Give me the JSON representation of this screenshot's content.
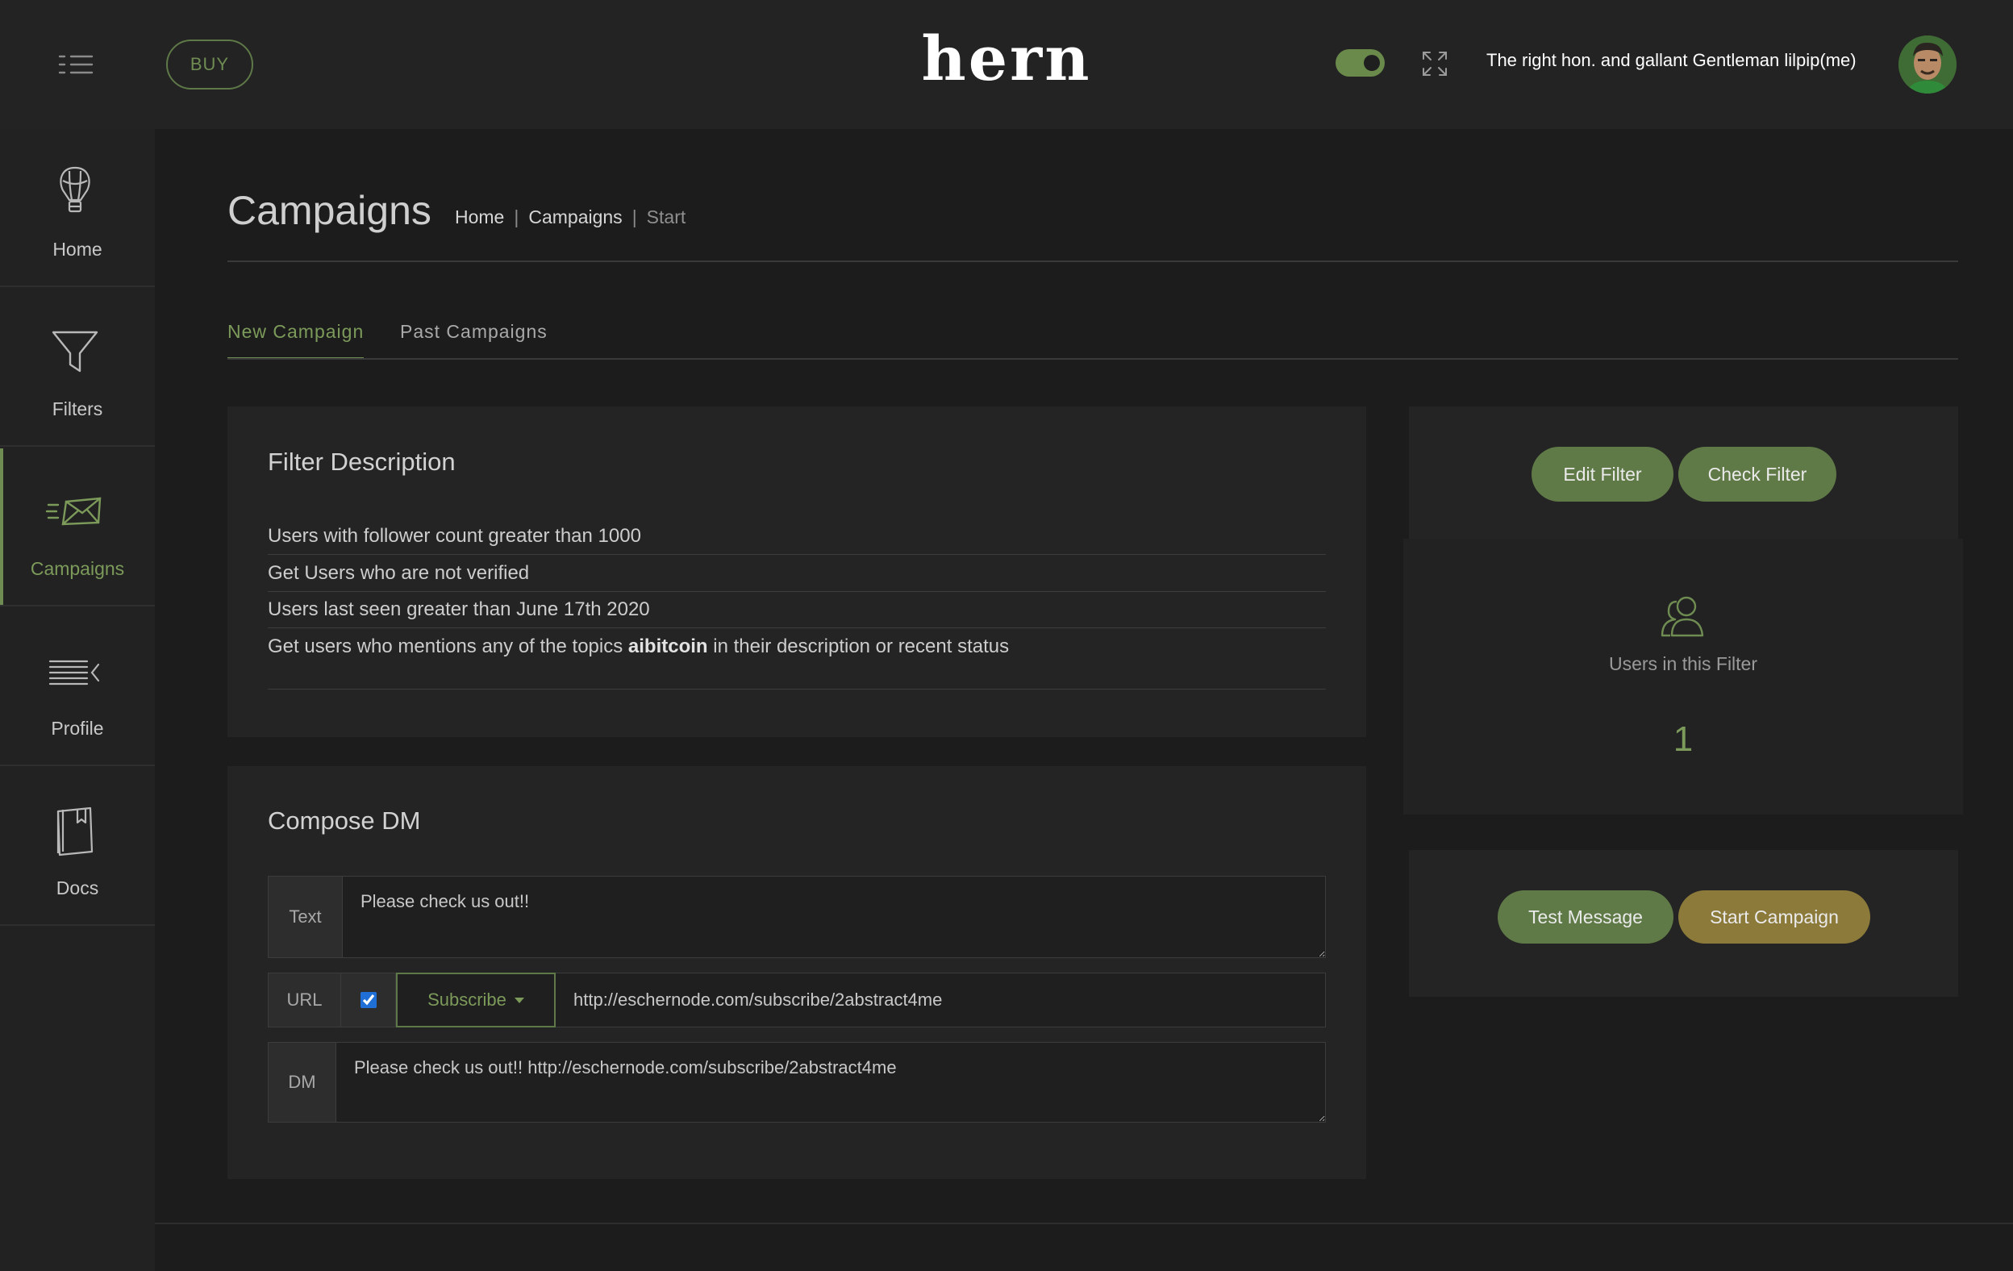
{
  "topbar": {
    "buy_label": "BUY",
    "logo": "hern",
    "username": "The right hon. and gallant Gentleman lilpip(me)",
    "theme_toggle_on": true
  },
  "sidebar": {
    "items": [
      {
        "label": "Home",
        "icon": "balloon-icon"
      },
      {
        "label": "Filters",
        "icon": "funnel-icon"
      },
      {
        "label": "Campaigns",
        "icon": "mail-icon",
        "active": true
      },
      {
        "label": "Profile",
        "icon": "lines-icon"
      },
      {
        "label": "Docs",
        "icon": "book-icon"
      }
    ]
  },
  "page": {
    "title": "Campaigns",
    "breadcrumb": [
      "Home",
      "Campaigns",
      "Start"
    ],
    "breadcrumb_sep": "|"
  },
  "tabs": [
    {
      "label": "New Campaign",
      "active": true
    },
    {
      "label": "Past Campaigns",
      "active": false
    }
  ],
  "filter_description": {
    "title": "Filter Description",
    "rows": [
      "Users with follower count greater than 1000",
      "Get Users who are not verified",
      "Users last seen greater than June 17th 2020"
    ],
    "topics_prefix": "Get users who mentions any of the topics",
    "topics_keyword": "aibitcoin",
    "topics_suffix": "in their description or recent status"
  },
  "compose": {
    "title": "Compose DM",
    "text_label": "Text",
    "text_value": "Please check us out!!",
    "url_label": "URL",
    "url_checked": true,
    "subscribe_label": "Subscribe",
    "url_value": "http://eschernode.com/subscribe/2abstract4me",
    "dm_label": "DM",
    "dm_value": "Please check us out!! http://eschernode.com/subscribe/2abstract4me"
  },
  "filter_actions": {
    "edit_label": "Edit Filter",
    "check_label": "Check Filter"
  },
  "users_panel": {
    "label": "Users in this Filter",
    "count": "1"
  },
  "campaign_actions": {
    "test_label": "Test Message",
    "start_label": "Start Campaign"
  },
  "colors": {
    "accent": "#6f8c52",
    "accent_text": "#7c9a5a",
    "gold": "#8b7a3a",
    "background": "#1c1c1c",
    "panel": "#242424"
  }
}
